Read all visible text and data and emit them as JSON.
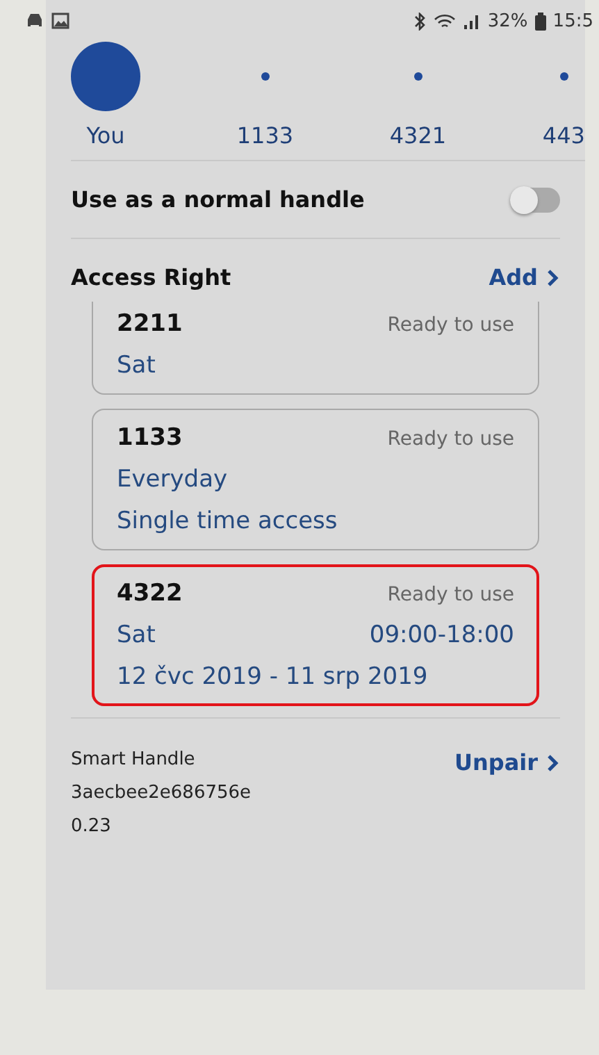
{
  "status_bar": {
    "battery": "32%",
    "time": "15:5"
  },
  "users": [
    {
      "label": "You",
      "selected": true
    },
    {
      "label": "1133",
      "selected": false
    },
    {
      "label": "4321",
      "selected": false
    },
    {
      "label": "443",
      "selected": false
    }
  ],
  "normal_handle": {
    "label": "Use as a normal handle",
    "on": false
  },
  "access": {
    "title": "Access Right",
    "action": "Add",
    "cards": [
      {
        "code": "2211",
        "status": "Ready to use",
        "highlighted": false,
        "clipped": true,
        "lines": [
          {
            "left": "Sat"
          }
        ]
      },
      {
        "code": "1133",
        "status": "Ready to use",
        "highlighted": false,
        "clipped": false,
        "lines": [
          {
            "left": "Everyday"
          },
          {
            "left": "Single time access"
          }
        ]
      },
      {
        "code": "4322",
        "status": "Ready to use",
        "highlighted": true,
        "clipped": false,
        "lines": [
          {
            "left": "Sat",
            "right": "09:00-18:00"
          },
          {
            "left": "12 čvc 2019 - 11 srp 2019"
          }
        ]
      }
    ]
  },
  "device": {
    "name": "Smart Handle",
    "id": "3aecbee2e686756e",
    "version": "0.23",
    "action": "Unpair"
  }
}
